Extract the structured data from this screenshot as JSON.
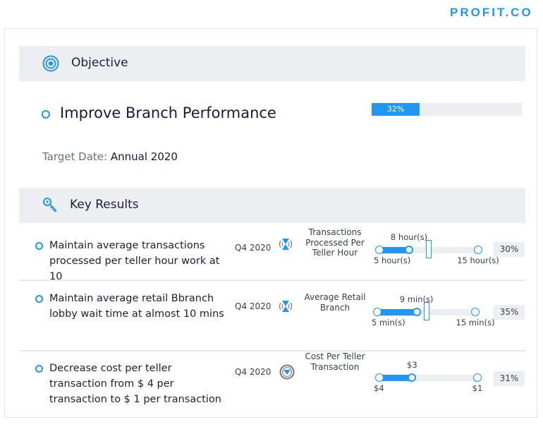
{
  "logo": "PROFIT.CO",
  "objective_section": {
    "label": "Objective",
    "icon": "target-icon"
  },
  "objective": {
    "title": "Improve Branch Performance",
    "progress_percent": 32,
    "progress_label": "32%",
    "target_date_label": "Target Date:",
    "target_date": "Annual 2020"
  },
  "key_results_section": {
    "label": "Key Results",
    "icon": "key-icon"
  },
  "colors": {
    "accent": "#2196f3",
    "band": "#eceef2"
  },
  "key_results": [
    {
      "text": "Maintain average transactions processed per teller hour work at 10",
      "period": "Q4 2020",
      "trend_icon": "hourglass-signal-icon",
      "metric": "Transactions Processed Per Teller Hour",
      "start": 5,
      "start_label": "5 hour(s)",
      "end": 15,
      "end_label": "15 hour(s)",
      "current": 8,
      "current_label": "8 hour(s)",
      "target": 10,
      "percent": "30%"
    },
    {
      "text": "Maintain average retail Bbranch lobby wait time at almost 10 mins",
      "period": "Q4 2020",
      "trend_icon": "hourglass-signal-icon",
      "metric": "Average Retail Branch",
      "start": 5,
      "start_label": "5 min(s)",
      "end": 15,
      "end_label": "15 min(s)",
      "current": 9,
      "current_label": "9 min(s)",
      "target": 10,
      "percent": "35%"
    },
    {
      "text": "Decrease cost per teller transaction from $ 4 per transaction to $ 1 per transaction",
      "period": "Q4 2020",
      "trend_icon": "decrease-arrow-icon",
      "metric": "Cost Per Teller Transaction",
      "start": 4,
      "start_label": "$4",
      "end": 1,
      "end_label": "$1",
      "current": 3,
      "current_label": "$3",
      "percent": "31%"
    }
  ]
}
